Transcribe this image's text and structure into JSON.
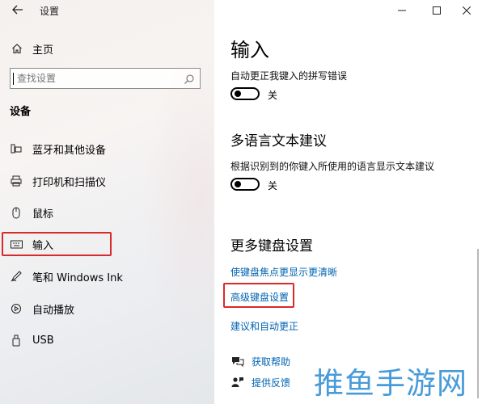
{
  "window": {
    "title": "设置"
  },
  "sidebar": {
    "home_label": "主页",
    "search_placeholder": "查找设置",
    "section_title": "设备",
    "items": [
      {
        "label": "蓝牙和其他设备",
        "icon": "bluetooth-devices-icon"
      },
      {
        "label": "打印机和扫描仪",
        "icon": "printer-icon"
      },
      {
        "label": "鼠标",
        "icon": "mouse-icon"
      },
      {
        "label": "输入",
        "icon": "keyboard-icon",
        "selected": true
      },
      {
        "label": "笔和 Windows Ink",
        "icon": "pen-icon"
      },
      {
        "label": "自动播放",
        "icon": "autoplay-icon"
      },
      {
        "label": "USB",
        "icon": "usb-icon"
      }
    ]
  },
  "main": {
    "page_title": "输入",
    "autocorrect": {
      "label": "自动更正我键入的拼写错误",
      "state": "关"
    },
    "multilingual": {
      "heading": "多语言文本建议",
      "description": "根据识别到的你键入所使用的语言显示文本建议",
      "state": "关"
    },
    "more_keyboard": {
      "heading": "更多键盘设置",
      "links": [
        "使键盘焦点更显示更清晰",
        "高级键盘设置",
        "建议和自动更正"
      ]
    },
    "help": {
      "get_help": "获取帮助",
      "feedback": "提供反馈"
    }
  },
  "watermark": "推鱼手游网",
  "colors": {
    "link": "#0063b1",
    "highlight_border": "#d9292a"
  }
}
